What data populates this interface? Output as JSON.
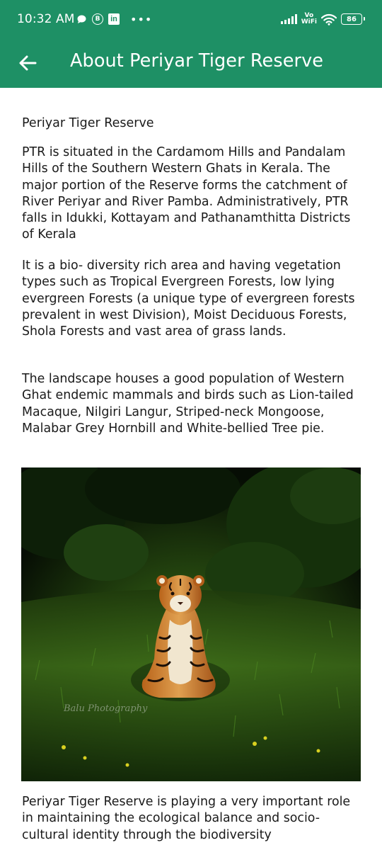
{
  "status_bar": {
    "time": "10:32 AM",
    "left_icons": [
      "chat-icon",
      "b-icon",
      "linkedin-icon",
      "more-dots-icon"
    ],
    "vowifi_line1": "Vo",
    "vowifi_line2": "WiFi",
    "battery": "86"
  },
  "toolbar": {
    "back_icon": "arrow-left-icon",
    "title": "About Periyar Tiger Reserve",
    "background": "#1e9065"
  },
  "content": {
    "heading": "Periyar Tiger Reserve",
    "paragraphs": [
      "PTR is situated in the Cardamom Hills and Pandalam Hills of the Southern Western Ghats in Kerala. The major portion of the Reserve forms the catchment of River Periyar and River Pamba. Administratively, PTR falls in Idukki, Kottayam and Pathanamthitta Districts of Kerala",
      "It is a bio- diversity rich area and having vegetation types such as Tropical Evergreen Forests, low lying evergreen Forests (a unique type of evergreen forests prevalent in west Division), Moist Deciduous Forests, Shola Forests and vast area of grass lands.",
      "The landscape houses a good population of Western Ghat endemic mammals and birds such as Lion-tailed Macaque, Nilgiri Langur, Striped-neck Mongoose, Malabar Grey Hornbill and White-bellied Tree pie.",
      "Periyar Tiger Reserve is playing a very important role in maintaining the ecological balance and socio-cultural identity through the biodiversity"
    ],
    "photo_watermark": "Balu Photography"
  }
}
